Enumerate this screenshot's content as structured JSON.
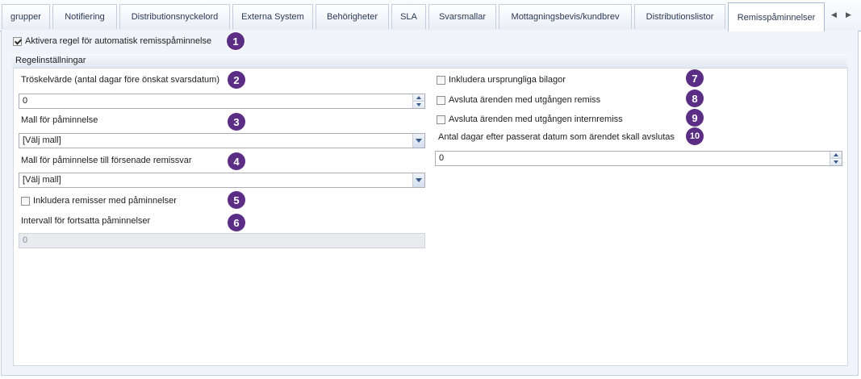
{
  "tabs": [
    {
      "label": "grupper"
    },
    {
      "label": "Notifiering"
    },
    {
      "label": "Distributionsnyckelord"
    },
    {
      "label": "Externa System"
    },
    {
      "label": "Behörigheter"
    },
    {
      "label": "SLA"
    },
    {
      "label": "Svarsmallar"
    },
    {
      "label": "Mottagningsbevis/kundbrev"
    },
    {
      "label": "Distributionslistor"
    },
    {
      "label": "Remisspåminnelser"
    }
  ],
  "active_tab": "Remisspåminnelser",
  "tab_scroll": {
    "left_icon": "triangle-left-icon",
    "right_icon": "triangle-right-icon"
  },
  "activate_rule": {
    "label": "Aktivera regel för automatisk remisspåminnelse",
    "checked": true
  },
  "group_title": "Regelinställningar",
  "left": {
    "threshold_label": "Tröskelvärde (antal dagar före önskat svarsdatum)",
    "threshold_value": "0",
    "reminder_template_label": "Mall för påminnelse",
    "reminder_template_value": "[Välj mall]",
    "late_template_label": "Mall för påminnelse till försenade remissvar",
    "late_template_value": "[Välj mall]",
    "include_reminders_label": "Inkludera remisser med påminnelser",
    "include_reminders_checked": false,
    "interval_label": "Intervall för fortsatta påminnelser",
    "interval_value": "0"
  },
  "right": {
    "include_attachments_label": "Inkludera ursprungliga bilagor",
    "include_attachments_checked": false,
    "close_expired_label": "Avsluta ärenden med utgången remiss",
    "close_expired_checked": false,
    "close_internal_label": "Avsluta ärenden med utgången internremiss",
    "close_internal_checked": false,
    "days_after_label": "Antal dagar efter passerat datum som ärendet skall avslutas",
    "days_after_value": "0"
  },
  "badges": [
    "1",
    "2",
    "3",
    "4",
    "5",
    "6",
    "7",
    "8",
    "9",
    "10"
  ],
  "colors": {
    "badge": "#5b2d84",
    "tab_border": "#a9bcd6",
    "panel_bg": "#f1f5fb"
  }
}
